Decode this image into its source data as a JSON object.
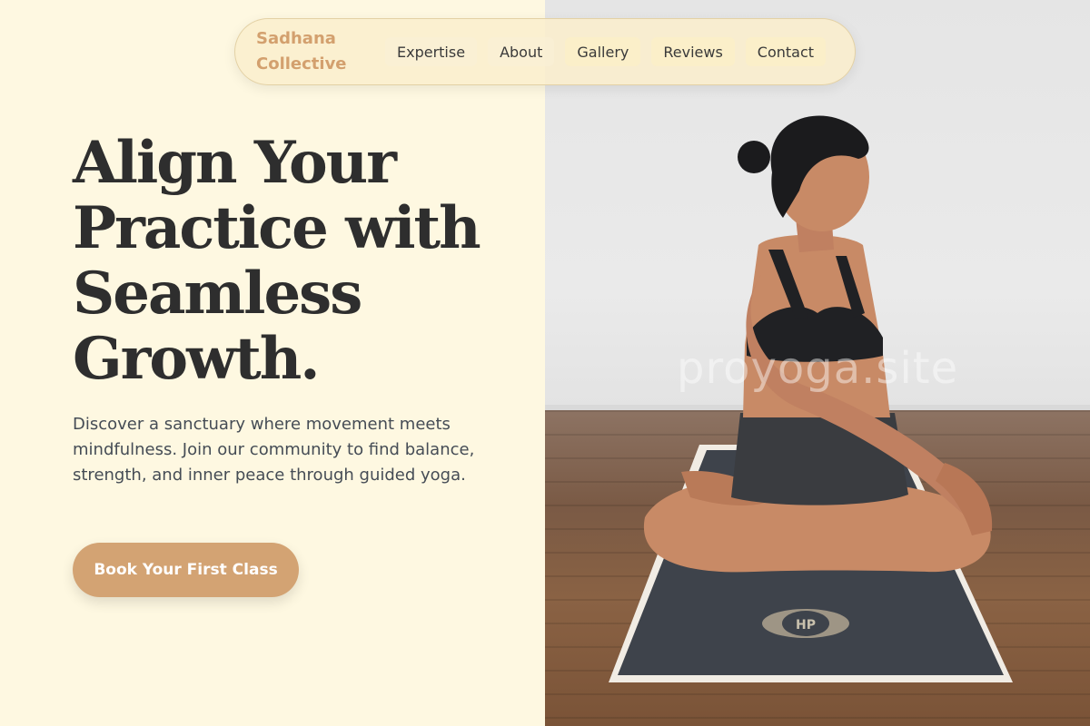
{
  "nav": {
    "brand_line1": "Sadhana",
    "brand_line2": "Collective",
    "links": [
      {
        "label": "Expertise"
      },
      {
        "label": "About"
      },
      {
        "label": "Gallery"
      },
      {
        "label": "Reviews"
      },
      {
        "label": "Contact"
      }
    ]
  },
  "hero": {
    "title_lines": [
      "Align Your",
      "Practice with",
      "Seamless",
      "Growth."
    ],
    "description": "Discover a sanctuary where movement meets mindfulness. Join our community to find balance, strength, and inner peace through guided yoga.",
    "cta_label": "Book Your First Class"
  },
  "photo": {
    "watermark": "proyoga.site"
  },
  "colors": {
    "background": "#fef8e1",
    "accent": "#d3a373",
    "brand": "#d3a06e",
    "heading": "#2e2e2e",
    "body_text": "#454c55"
  }
}
